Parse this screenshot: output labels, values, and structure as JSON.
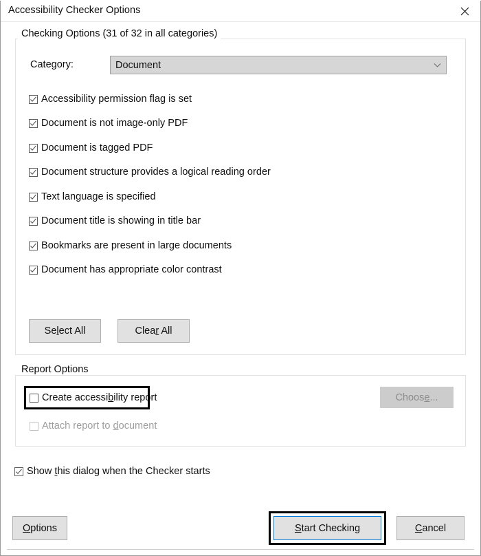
{
  "window": {
    "title": "Accessibility Checker Options",
    "close_icon": "close-icon"
  },
  "checking_options": {
    "group_title": "Checking Options (31 of 32 in all categories)",
    "category": {
      "label": "Category:",
      "value": "Document",
      "arrow_icon": "chevron-down-icon"
    },
    "items": [
      {
        "label": "Accessibility permission flag is set",
        "checked": true
      },
      {
        "label": "Document is not image-only PDF",
        "checked": true
      },
      {
        "label": "Document is tagged PDF",
        "checked": true
      },
      {
        "label": "Document structure provides a logical reading order",
        "checked": true
      },
      {
        "label": "Text language is specified",
        "checked": true
      },
      {
        "label": "Document title is showing in title bar",
        "checked": true
      },
      {
        "label": "Bookmarks are present in large documents",
        "checked": true
      },
      {
        "label": "Document has appropriate color contrast",
        "checked": true
      }
    ],
    "select_all_label": "Select All",
    "select_all_accel": "l",
    "clear_all_label": "Clear All",
    "clear_all_accel": "r"
  },
  "report_options": {
    "group_title": "Report Options",
    "create_report": {
      "label": "Create accessibility report",
      "accel": "b",
      "checked": false,
      "focused": true
    },
    "attach_report": {
      "label": "Attach report to document",
      "accel": "d",
      "checked": false,
      "enabled": false
    },
    "choose_label": "Choose...",
    "choose_accel": "e",
    "choose_enabled": false
  },
  "show_dialog": {
    "label": "Show this dialog when the Checker starts",
    "accel": "t",
    "checked": true
  },
  "footer": {
    "options_label": "Options",
    "options_accel": "O",
    "start_checking_label": "Start Checking",
    "start_checking_accel": "S",
    "start_checking_is_default": true,
    "cancel_label": "Cancel",
    "cancel_accel": "C"
  },
  "colors": {
    "accent": "#0078d7",
    "button_face": "#e1e1e1",
    "button_border": "#adadad",
    "disabled_face": "#cccccc",
    "disabled_text": "#8d8d8d",
    "combo_face": "#d6d6d6",
    "group_border": "#e2e2e2",
    "text": "#0f0f0f",
    "focus_rect": "#000000"
  }
}
